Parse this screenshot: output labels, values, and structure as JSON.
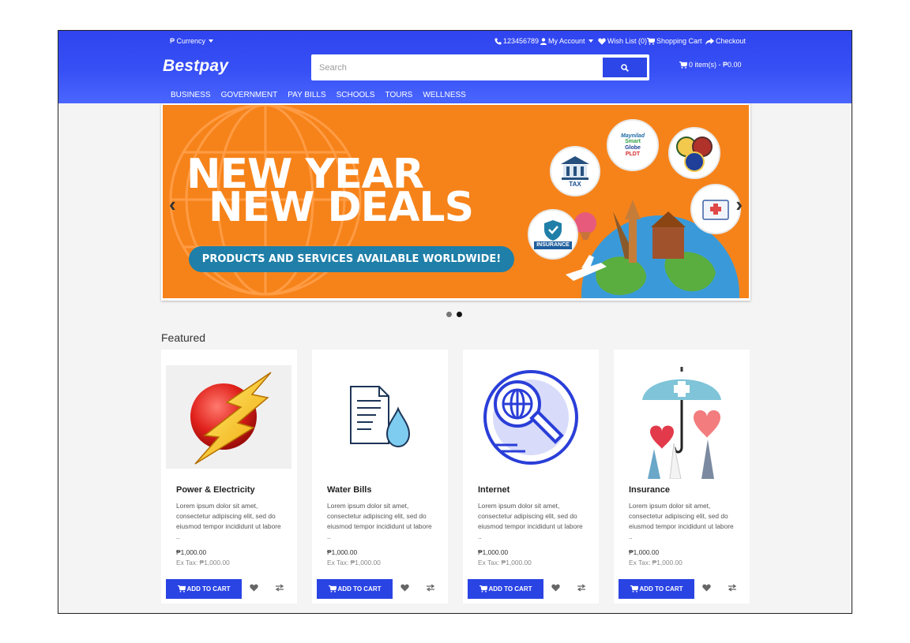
{
  "topbar": {
    "currency": "₱ Currency",
    "phone": "123456789",
    "account": "My Account",
    "wishlist": "Wish List (0)",
    "cart": "Shopping Cart",
    "checkout": "Checkout"
  },
  "brand": {
    "logo": "Bestpay"
  },
  "search": {
    "placeholder": "Search",
    "value": ""
  },
  "cart_summary": "0 item(s) - ₱0.00",
  "nav": [
    "BUSINESS",
    "GOVERNMENT",
    "PAY BILLS",
    "SCHOOLS",
    "TOURS",
    "WELLNESS"
  ],
  "banner": {
    "line1": "NEW YEAR",
    "line2": "NEW DEALS",
    "tagline": "PRODUCTS AND SERVICES AVAILABLE WORLDWIDE!",
    "badge_tax": "TAX",
    "badge_insurance": "INSURANCE",
    "badge_telco": [
      "Maynilad",
      "Smart",
      "Globe",
      "PLDT"
    ]
  },
  "carousel": {
    "slides": 2,
    "active": 2
  },
  "featured": {
    "title": "Featured",
    "products": [
      {
        "name": "Power & Electricity",
        "desc": "Lorem ipsum dolor sit amet, consectetur adipiscing elit, sed do eiusmod tempor incididunt ut labore ..",
        "price": "₱1,000.00",
        "extax": "Ex Tax: ₱1,000.00",
        "add_label": "ADD TO CART",
        "icon": "lightning-icon"
      },
      {
        "name": "Water Bills",
        "desc": "Lorem ipsum dolor sit amet, consectetur adipiscing elit, sed do eiusmod tempor incididunt ut labore ..",
        "price": "₱1,000.00",
        "extax": "Ex Tax: ₱1,000.00",
        "add_label": "ADD TO CART",
        "icon": "water-bill-icon"
      },
      {
        "name": "Internet",
        "desc": "Lorem ipsum dolor sit amet, consectetur adipiscing elit, sed do eiusmod tempor incididunt ut labore ..",
        "price": "₱1,000.00",
        "extax": "Ex Tax: ₱1,000.00",
        "add_label": "ADD TO CART",
        "icon": "globe-search-icon"
      },
      {
        "name": "Insurance",
        "desc": "Lorem ipsum dolor sit amet, consectetur adipiscing elit, sed do eiusmod tempor incididunt ut labore ..",
        "price": "₱1,000.00",
        "extax": "Ex Tax: ₱1,000.00",
        "add_label": "ADD TO CART",
        "icon": "umbrella-health-icon"
      }
    ]
  },
  "colors": {
    "primary": "#2c46e8",
    "banner_orange": "#f6831a",
    "pill_blue": "#1f7fa8"
  }
}
